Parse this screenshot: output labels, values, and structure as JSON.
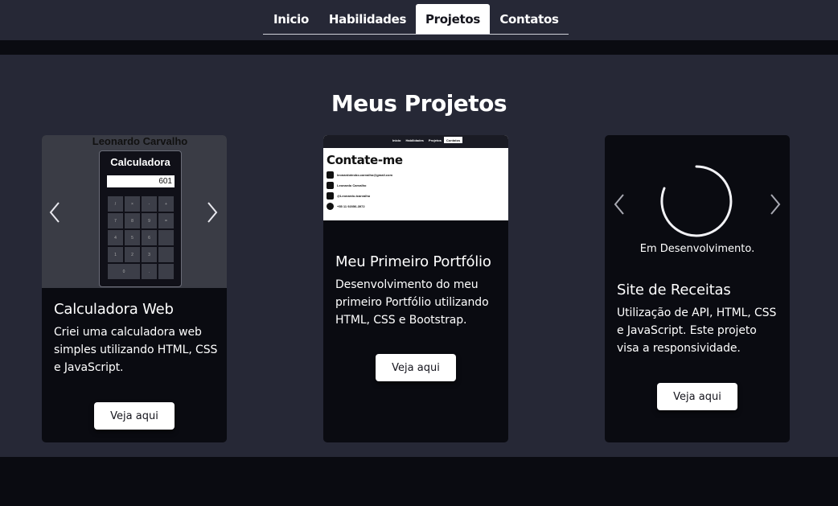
{
  "nav": {
    "items": [
      "Inicio",
      "Habilidades",
      "Projetos",
      "Contatos"
    ],
    "active": "Projetos"
  },
  "section": {
    "title": "Meus Projetos"
  },
  "colors": {
    "bg": "#262836",
    "card": "#0a0b11",
    "accent": "#ffffff"
  },
  "projects": [
    {
      "title": "Calculadora Web",
      "description": "Criei uma calculadora web simples utilizando HTML, CSS e JavaScript.",
      "button": "Veja aqui",
      "preview": {
        "owner": "Leonardo Carvalho",
        "app_title": "Calculadora",
        "display_value": "601",
        "keys": [
          "/",
          "×",
          "-",
          "+",
          "7",
          "8",
          "9",
          "=",
          "4",
          "5",
          "6",
          "",
          "1",
          "2",
          "3",
          "",
          "0",
          "",
          ".",
          ""
        ],
        "icons": [
          "chevron-left-icon",
          "chevron-right-icon"
        ]
      }
    },
    {
      "title": "Meu Primeiro Portfólio",
      "description": "Desenvolvimento do meu primeiro Portfólio utilizando HTML, CSS e Bootstrap.",
      "button": "Veja aqui",
      "preview": {
        "nav": [
          "Inicio",
          "Habilidades",
          "Projetos",
          "Contatos"
        ],
        "heading": "Contate-me",
        "contacts": [
          {
            "icon": "mail-icon",
            "text": "leonardoteobo.carvalho@gmail.com"
          },
          {
            "icon": "linkedin-icon",
            "text": "Leonardo Carvalho"
          },
          {
            "icon": "github-icon",
            "text": "@Leonardo-tcarvalho"
          },
          {
            "icon": "whatsapp-icon",
            "text": "+55 11 92056-3972"
          }
        ]
      }
    },
    {
      "title": "Site de Receitas",
      "description": "Utilização de API, HTML, CSS e JavaScript. Este projeto visa a responsividade.",
      "button": "Veja aqui",
      "preview": {
        "status": "Em Desenvolvimento.",
        "icons": [
          "loading-spinner-icon",
          "chevron-left-icon",
          "chevron-right-icon"
        ]
      }
    }
  ]
}
